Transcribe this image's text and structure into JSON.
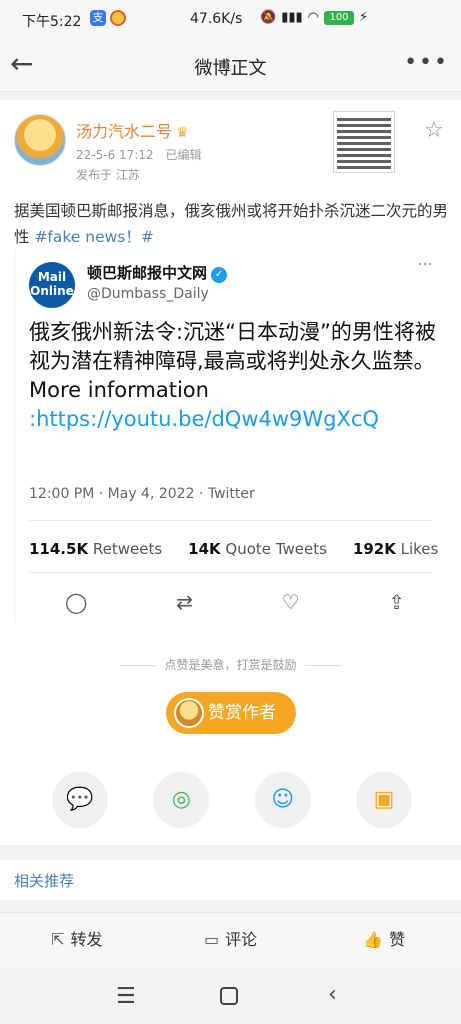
{
  "statusbar": {
    "time": "下午5:22",
    "speed": "47.6K/s",
    "battery": "100"
  },
  "nav": {
    "title": "微博正文"
  },
  "post": {
    "author": "汤力汽水二号",
    "date": "22-5-6 17:12",
    "edited": "已编辑",
    "location": "发布于 江苏",
    "text_plain": "据美国顿巴斯邮报消息，俄亥俄州或将开始扑杀沉迷二次元的男性 ",
    "text_tag": "#fake news！#"
  },
  "tweet": {
    "logo_text": "Mail Online",
    "name": "顿巴斯邮报中文网",
    "handle": "@Dumbass_Daily",
    "body": "俄亥俄州新法令:沉迷“日本动漫”的男性将被视为潜在精神障碍,最高或将判处永久监禁。",
    "more_info": "More information",
    "link": ":https://youtu.be/dQw4w9WgXcQ",
    "timestamp": "12:00 PM · May 4, 2022 · Twitter",
    "retweets_count": "114.5K",
    "retweets_label": "Retweets",
    "quotes_count": "14K",
    "quotes_label": "Quote Tweets",
    "likes_count": "192K",
    "likes_label": "Likes"
  },
  "reward": {
    "divider": "点赞是美意，打赏是鼓励",
    "button": "赞赏作者"
  },
  "related": {
    "label": "相关推荐"
  },
  "actions": {
    "repost": "转发",
    "comment": "评论",
    "like": "赞"
  }
}
